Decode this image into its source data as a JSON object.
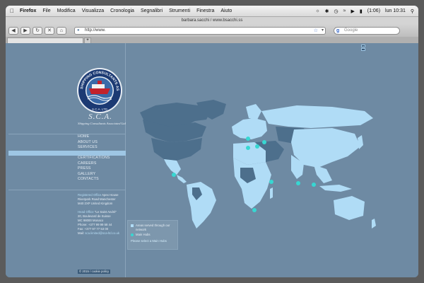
{
  "menubar": {
    "apple_icon": "apple-logo",
    "items": [
      "Firefox",
      "File",
      "Modifica",
      "Visualizza",
      "Cronologia",
      "Segnalibri",
      "Strumenti",
      "Finestra",
      "Aiuto"
    ],
    "battery": "(1:06)",
    "clock": "lun 10:31"
  },
  "window": {
    "title": "barbara.sacchi / www.bsacchi.ss"
  },
  "toolbar": {
    "back_icon": "back-arrow",
    "forward_icon": "forward-arrow",
    "url": "http://www.",
    "search_placeholder": "Google"
  },
  "tabs": [
    {
      "label": ""
    }
  ],
  "site": {
    "logo_ring_text": "SHIPPING CONSULTANTS ASSOCIATED",
    "logo_ltd": "S.C.A. LTD",
    "brand": "S.C.A.",
    "tagline": "Shipping Consultants Associated Ltd",
    "nav": [
      "HOME",
      "ABOUT US",
      "SERVICES",
      "",
      "CERTIFICATIONS",
      "CAREERS",
      "PRESS",
      "GALLERY",
      "CONTACTS"
    ],
    "active_index": 3,
    "contact": {
      "reg_label": "Registered Office",
      "reg_value": "Apex House",
      "reg_line2": "Riverpark Road Manchester",
      "reg_line3": "M40 2XP United Kingdom",
      "head_label": "Head Office",
      "head_value": "\"Le Saint André\"",
      "head_line2": "20, Boulevard de Suisse",
      "head_line3": "MC 98000 Monaco",
      "phone": "Phone: +377 99 99 58 44",
      "fax": "Fax: +377 97 77 53 00",
      "mail_label": "Mail:",
      "mail_value": "sca.limited@sca-ltd.co.uk"
    },
    "footer": "© 2015 / cookie policy",
    "legend": {
      "areas": "Areas served through our network",
      "hubs": "Main Hubs",
      "hint": "Please select a Main Hubs"
    },
    "colors": {
      "page_bg": "#6e8aa3",
      "served_land": "#b0dcf6",
      "other_land": "#4d6f8c",
      "hub": "#37d7d2"
    }
  }
}
